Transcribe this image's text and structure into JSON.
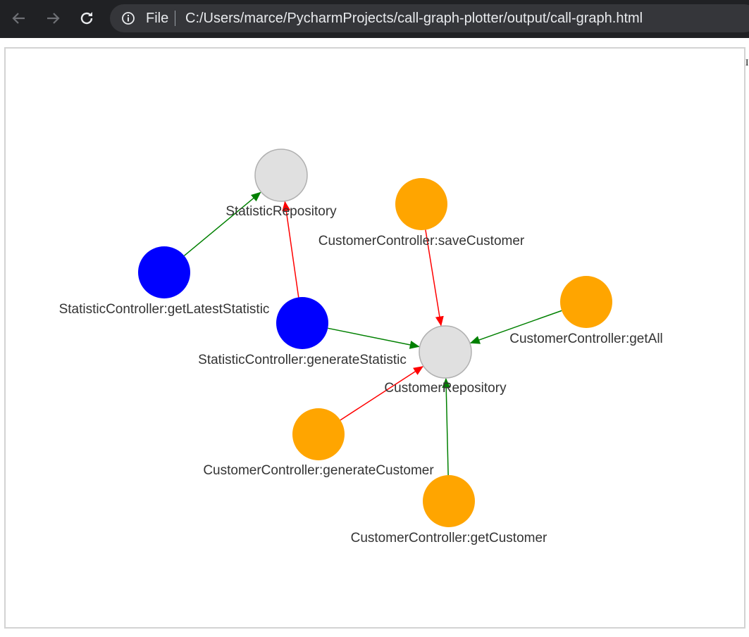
{
  "browser": {
    "protocol_label": "File",
    "url": "C:/Users/marce/PycharmProjects/call-graph-plotter/output/call-graph.html",
    "icons": {
      "back": "arrow-left-icon",
      "forward": "arrow-right-icon",
      "reload": "reload-icon",
      "info": "info-circle-icon"
    }
  },
  "page": {
    "stray_char": "I"
  },
  "graph": {
    "colors": {
      "repository": "#e0e0e0",
      "repository_border": "#b0b0b0",
      "statistic_controller": "#0000ff",
      "customer_controller": "#ffa500",
      "edge_green": "#008000",
      "edge_red": "#ff0000",
      "label": "#343434"
    },
    "nodes": [
      {
        "id": "statistic-repository",
        "label": "StatisticRepository",
        "group": "repository"
      },
      {
        "id": "customer-repository",
        "label": "CustomerRepository",
        "group": "repository"
      },
      {
        "id": "statistic-get-latest",
        "label": "StatisticController:getLatestStatistic",
        "group": "statistic_controller"
      },
      {
        "id": "statistic-generate",
        "label": "StatisticController:generateStatistic",
        "group": "statistic_controller"
      },
      {
        "id": "customer-save",
        "label": "CustomerController:saveCustomer",
        "group": "customer_controller"
      },
      {
        "id": "customer-get-all",
        "label": "CustomerController:getAll",
        "group": "customer_controller"
      },
      {
        "id": "customer-generate",
        "label": "CustomerController:generateCustomer",
        "group": "customer_controller"
      },
      {
        "id": "customer-get",
        "label": "CustomerController:getCustomer",
        "group": "customer_controller"
      }
    ],
    "edges": [
      {
        "from": "statistic-get-latest",
        "to": "statistic-repository",
        "color": "green"
      },
      {
        "from": "statistic-generate",
        "to": "statistic-repository",
        "color": "red"
      },
      {
        "from": "statistic-generate",
        "to": "customer-repository",
        "color": "green"
      },
      {
        "from": "customer-save",
        "to": "customer-repository",
        "color": "red"
      },
      {
        "from": "customer-get-all",
        "to": "customer-repository",
        "color": "green"
      },
      {
        "from": "customer-generate",
        "to": "customer-repository",
        "color": "red"
      },
      {
        "from": "customer-get",
        "to": "customer-repository",
        "color": "green"
      }
    ]
  }
}
